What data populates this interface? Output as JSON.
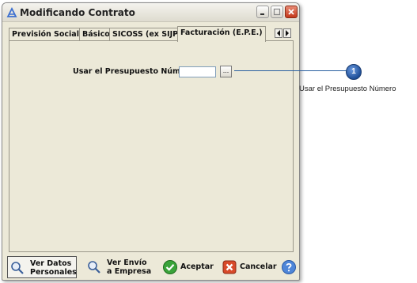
{
  "window": {
    "title": "Modificando Contrato"
  },
  "tabs": [
    {
      "label": "Previsión Social"
    },
    {
      "label": "Básico"
    },
    {
      "label": "SICOSS (ex SIJP)"
    },
    {
      "label": "Facturación (E.P.E.)",
      "active": true
    }
  ],
  "form": {
    "presupuesto_label": "Usar el Presupuesto Número:",
    "presupuesto_value": "",
    "browse_label": "..."
  },
  "toolbar": {
    "ver_datos_line1": "Ver Datos",
    "ver_datos_line2": "Personales",
    "ver_envio_line1": "Ver Envío",
    "ver_envio_line2": "a Empresa",
    "aceptar": "Aceptar",
    "cancelar": "Cancelar"
  },
  "callout": {
    "number": "1",
    "text": "Usar el Presupuesto Número"
  },
  "colors": {
    "window_bg": "#ece9d8",
    "accent": "#1f4f98",
    "close": "#c4381b"
  }
}
